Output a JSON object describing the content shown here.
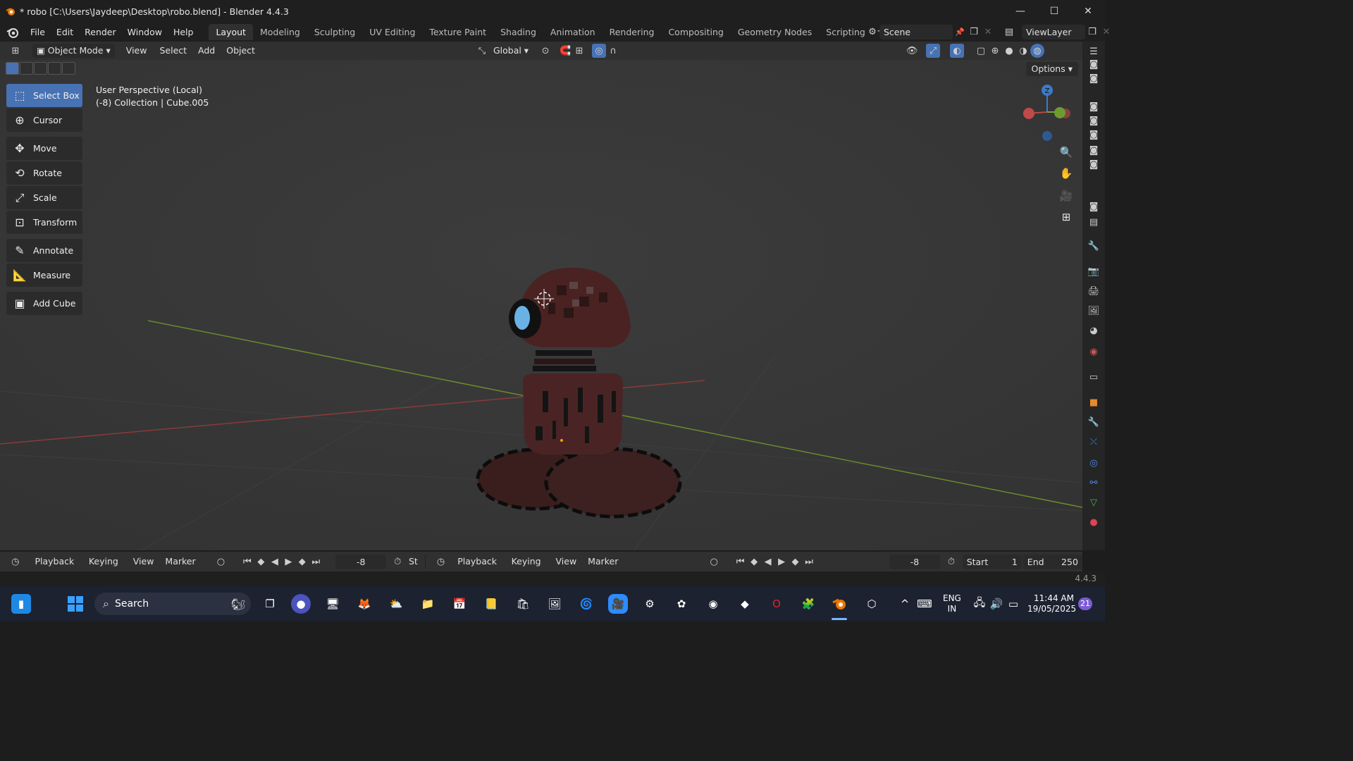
{
  "window": {
    "title": "* robo [C:\\Users\\Jaydeep\\Desktop\\robo.blend] - Blender 4.4.3",
    "minimize": "—",
    "maximize": "☐",
    "close": "✕"
  },
  "menu": [
    "File",
    "Edit",
    "Render",
    "Window",
    "Help"
  ],
  "workspaces": [
    "Layout",
    "Modeling",
    "Sculpting",
    "UV Editing",
    "Texture Paint",
    "Shading",
    "Animation",
    "Rendering",
    "Compositing",
    "Geometry Nodes",
    "Scripting"
  ],
  "active_workspace": "Layout",
  "scene_name": "Scene",
  "view_layer": "ViewLayer",
  "viewport_header": {
    "mode": "Object Mode",
    "menus": [
      "View",
      "Select",
      "Add",
      "Object"
    ],
    "orientation": "Global",
    "options_label": "Options"
  },
  "overlay": {
    "perspective": "User Perspective (Local)",
    "collection": "(-8) Collection | Cube.005"
  },
  "tools": [
    "Select Box",
    "Cursor",
    "Move",
    "Rotate",
    "Scale",
    "Transform",
    "Annotate",
    "Measure",
    "Add Cube"
  ],
  "active_tool": "Select Box",
  "gizmo": {
    "z": "Z"
  },
  "timeline": {
    "left": {
      "playback": "Playback",
      "keying": "Keying",
      "view": "View",
      "marker": "Marker",
      "frame": "-8",
      "st": "St"
    },
    "right": {
      "playback": "Playback",
      "keying": "Keying",
      "view": "View",
      "marker": "Marker",
      "frame": "-8",
      "start_label": "Start",
      "start": "1",
      "end_label": "End",
      "end": "250"
    }
  },
  "statusbar": {
    "version": "4.4.3"
  },
  "taskbar": {
    "search_placeholder": "Search",
    "lang_top": "ENG",
    "lang_bottom": "IN",
    "time": "11:44 AM",
    "date": "19/05/2025",
    "notifications": "21"
  },
  "colors": {
    "accent": "#4772b3",
    "axis_x": "#8b3a3a",
    "axis_y": "#6b8a2c",
    "robot_body": "#4a2424"
  }
}
